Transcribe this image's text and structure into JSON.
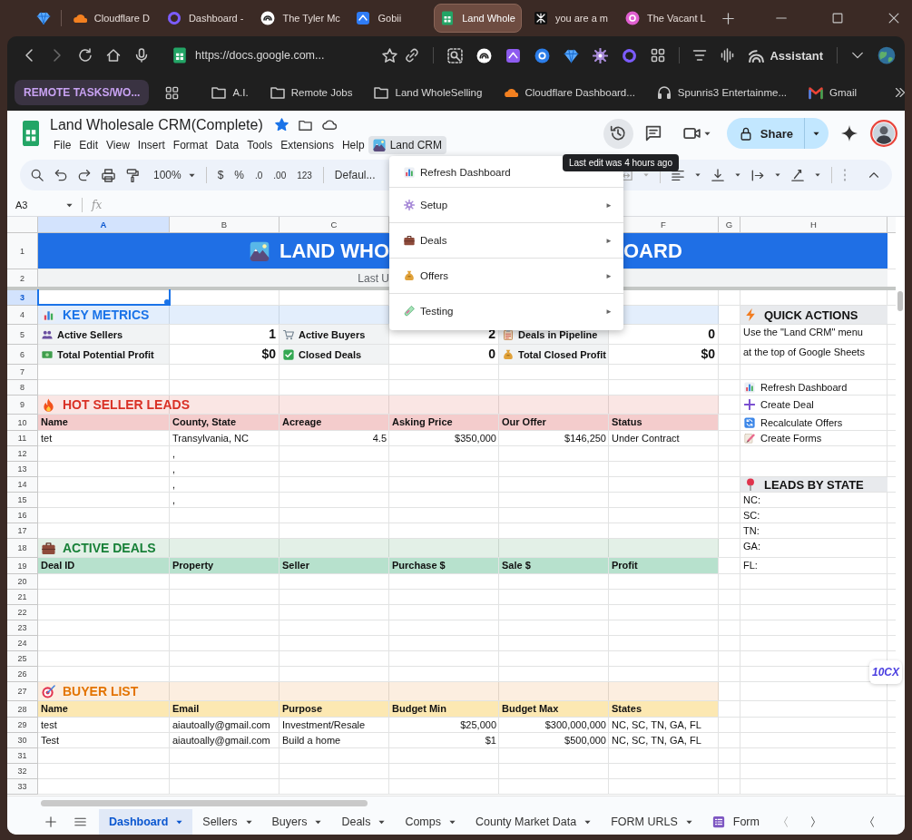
{
  "browser": {
    "tabs": [
      {
        "title": "Cloudflare D",
        "selected": false
      },
      {
        "title": "Dashboard -",
        "selected": false
      },
      {
        "title": "The Tyler Mc",
        "selected": false
      },
      {
        "title": "Gobii",
        "selected": false
      },
      {
        "title": "Land Whole",
        "selected": true
      },
      {
        "title": "you are a m",
        "selected": false
      },
      {
        "title": "The Vacant L",
        "selected": false
      }
    ],
    "url": "https://docs.google.com...",
    "assistant": "Assistant",
    "bookmarks": [
      {
        "label": "REMOTE TASKS/WO...",
        "kind": "group"
      },
      {
        "label": "A.I.",
        "kind": "folder"
      },
      {
        "label": "Remote Jobs",
        "kind": "folder"
      },
      {
        "label": "Land WholeSelling",
        "kind": "folder"
      },
      {
        "label": "Cloudflare Dashboard...",
        "kind": "cloud"
      },
      {
        "label": "Spunris3 Entertainme...",
        "kind": "headphones"
      },
      {
        "label": "Gmail",
        "kind": "mail"
      }
    ]
  },
  "doc": {
    "title": "Land Wholesale CRM(Complete)",
    "starred": true,
    "menus": [
      {
        "label": "File",
        "selected": false
      },
      {
        "label": "Edit",
        "selected": false
      },
      {
        "label": "View",
        "selected": false
      },
      {
        "label": "Insert",
        "selected": false
      },
      {
        "label": "Format",
        "selected": false
      },
      {
        "label": "Data",
        "selected": false
      },
      {
        "label": "Tools",
        "selected": false
      },
      {
        "label": "Extensions",
        "selected": false
      },
      {
        "label": "Help",
        "selected": false
      },
      {
        "label": "Land CRM",
        "selected": true,
        "kind": "custom"
      }
    ],
    "share": "Share",
    "tooltip": "Last edit was 4 hours ago"
  },
  "toolbar": {
    "zoom": "100%",
    "currency": "$",
    "percent": "%",
    "decrease_decimals": ".0",
    "increase_decimals": ".00",
    "number_format": "123",
    "font": "Defaul..."
  },
  "formula_bar": {
    "cell": "A3",
    "fx": "fx"
  },
  "columns": [
    {
      "label": "A",
      "selected": true
    },
    {
      "label": "B",
      "selected": false
    },
    {
      "label": "C",
      "selected": false
    },
    null,
    null,
    {
      "label": "F",
      "selected": false
    },
    {
      "label": "G",
      "selected": false
    },
    {
      "label": "H",
      "selected": false
    }
  ],
  "rows": [
    {
      "n": "1",
      "kind": "title",
      "selected": false,
      "text_start": "LAND WHO",
      "text_end": "OARD"
    },
    {
      "n": "2",
      "kind": "subtitle",
      "selected": false,
      "text_start": "Last U"
    },
    {
      "n": "3",
      "kind": "blank",
      "selected": true
    },
    {
      "n": "4",
      "kind": "section",
      "selected": false,
      "color": "#1a73e8",
      "title": "KEY METRICS",
      "side": {
        "kind": "heading",
        "text": "QUICK ACTIONS"
      }
    },
    {
      "n": "5",
      "kind": "metrics",
      "selected": false,
      "pairs": [
        {
          "label": "Active Sellers",
          "value": "1"
        },
        {
          "label": "Active Buyers",
          "value": "2"
        },
        {
          "label": "Deals in Pipeline",
          "value": "0"
        }
      ],
      "side": {
        "kind": "note",
        "text": "Use the \"Land CRM\" menu"
      }
    },
    {
      "n": "6",
      "kind": "metrics",
      "selected": false,
      "pairs": [
        {
          "label": "Total Potential Profit",
          "value": "$0"
        },
        {
          "label": "Closed Deals",
          "value": "0"
        },
        {
          "label": "Total Closed Profit",
          "value": "$0"
        }
      ],
      "side": {
        "kind": "note",
        "text": "at the top of Google Sheets"
      }
    },
    {
      "n": "7",
      "kind": "blank",
      "selected": false
    },
    {
      "n": "8",
      "kind": "blank",
      "selected": false,
      "side": {
        "kind": "action",
        "text": "Refresh Dashboard"
      }
    },
    {
      "n": "9",
      "kind": "section",
      "selected": false,
      "color": "#d93025",
      "title": "HOT SELLER LEADS",
      "side": {
        "kind": "action",
        "text": "Create Deal"
      }
    },
    {
      "n": "10",
      "kind": "table-header",
      "selected": false,
      "color": "#f4cccc",
      "columns": [
        {
          "label": "Name"
        },
        {
          "label": "County, State"
        },
        {
          "label": "Acreage",
          "kind": "number"
        },
        {
          "label": "Asking Price",
          "kind": "number"
        },
        {
          "label": "Our Offer",
          "kind": "number"
        },
        {
          "label": "Status"
        }
      ],
      "side": {
        "kind": "action",
        "text": "Recalculate Offers"
      }
    },
    {
      "n": "11",
      "kind": "table-row",
      "selected": false,
      "cells": {
        "A": "tet",
        "B": "Transylvania, NC",
        "C": "4.5",
        "D": "$350,000",
        "E": "$146,250",
        "F": "Under Contract"
      },
      "side": {
        "kind": "action",
        "text": "Create Forms"
      }
    },
    {
      "n": "12",
      "kind": "table-row",
      "selected": false,
      "cells": {
        "B": ","
      }
    },
    {
      "n": "13",
      "kind": "table-row",
      "selected": false,
      "cells": {
        "B": ","
      }
    },
    {
      "n": "14",
      "kind": "table-row",
      "selected": false,
      "cells": {
        "B": ","
      },
      "side": {
        "kind": "heading",
        "text": "LEADS BY STATE"
      }
    },
    {
      "n": "15",
      "kind": "table-row",
      "selected": false,
      "cells": {
        "B": ","
      },
      "side": {
        "kind": "note",
        "text": "NC:"
      }
    },
    {
      "n": "16",
      "kind": "blank",
      "selected": false,
      "side": {
        "kind": "note",
        "text": "SC:"
      }
    },
    {
      "n": "17",
      "kind": "blank",
      "selected": false,
      "side": {
        "kind": "note",
        "text": "TN:"
      }
    },
    {
      "n": "18",
      "kind": "section",
      "selected": false,
      "color": "#188038",
      "title": "ACTIVE DEALS",
      "side": {
        "kind": "note",
        "text": "GA:"
      }
    },
    {
      "n": "19",
      "kind": "table-header",
      "selected": false,
      "color": "#b7e1cd",
      "columns": [
        {
          "label": "Deal ID"
        },
        {
          "label": "Property"
        },
        {
          "label": "Seller"
        },
        {
          "label": "Purchase $"
        },
        {
          "label": "Sale $"
        },
        {
          "label": "Profit"
        }
      ],
      "side": {
        "kind": "note",
        "text": "FL:"
      }
    },
    {
      "n": "20",
      "kind": "blank",
      "selected": false
    },
    {
      "n": "21",
      "kind": "blank",
      "selected": false
    },
    {
      "n": "22",
      "kind": "blank",
      "selected": false
    },
    {
      "n": "23",
      "kind": "blank",
      "selected": false
    },
    {
      "n": "24",
      "kind": "blank",
      "selected": false
    },
    {
      "n": "25",
      "kind": "blank",
      "selected": false
    },
    {
      "n": "26",
      "kind": "blank",
      "selected": false
    },
    {
      "n": "27",
      "kind": "section",
      "selected": false,
      "color": "#e37400",
      "title": "BUYER LIST"
    },
    {
      "n": "28",
      "kind": "table-header",
      "selected": false,
      "color": "#fce8b2",
      "columns": [
        {
          "label": "Name"
        },
        {
          "label": "Email"
        },
        {
          "label": "Purpose"
        },
        {
          "label": "Budget Min",
          "kind": "number"
        },
        {
          "label": "Budget Max",
          "kind": "number"
        },
        {
          "label": "States"
        }
      ]
    },
    {
      "n": "29",
      "kind": "table-row",
      "selected": false,
      "cells": {
        "A": "test",
        "B": "aiautoally@gmail.com",
        "C": "Investment/Resale",
        "D": "$25,000",
        "E": "$300,000,000",
        "F": "NC, SC, TN, GA, FL"
      }
    },
    {
      "n": "30",
      "kind": "table-row",
      "selected": false,
      "cells": {
        "A": "Test",
        "B": "aiautoally@gmail.com",
        "C": "Build a home",
        "D": "$1",
        "E": "$500,000",
        "F": "NC, SC, TN, GA, FL"
      }
    },
    {
      "n": "31",
      "kind": "blank",
      "selected": false
    },
    {
      "n": "32",
      "kind": "blank",
      "selected": false
    },
    {
      "n": "33",
      "kind": "blank",
      "selected": false
    }
  ],
  "menu": {
    "items": [
      {
        "label": "Refresh Dashboard"
      },
      {
        "label": "Setup",
        "arrow": "►"
      },
      {
        "label": "Deals",
        "arrow": "►"
      },
      {
        "label": "Offers",
        "arrow": "►"
      },
      {
        "label": "Testing",
        "arrow": "►"
      }
    ]
  },
  "widget": "10CX",
  "sheet_tabs": [
    {
      "label": "Dashboard",
      "selected": true
    },
    {
      "label": "Sellers",
      "selected": false
    },
    {
      "label": "Buyers",
      "selected": false
    },
    {
      "label": "Deals",
      "selected": false
    },
    {
      "label": "Comps",
      "selected": false
    },
    {
      "label": "County Market Data",
      "selected": false
    },
    {
      "label": "FORM URLS",
      "selected": false
    },
    {
      "label": "Form",
      "selected": false,
      "kind": "form"
    }
  ]
}
